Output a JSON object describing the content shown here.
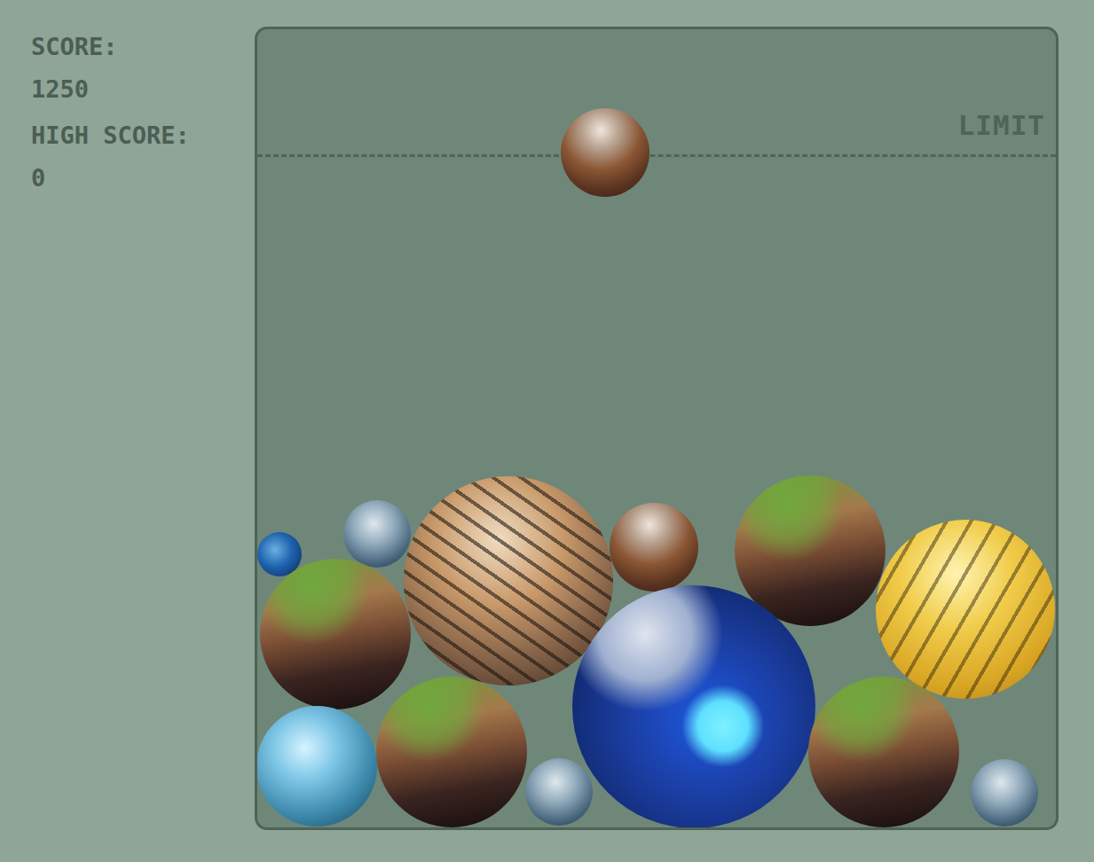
{
  "score": {
    "label": "SCORE:",
    "value": "1250"
  },
  "high_score": {
    "label": "HIGH SCORE:",
    "value": "0"
  },
  "board": {
    "limit_label": "LIMIT"
  },
  "dropping": {
    "kind": "rocky"
  },
  "planets": [
    {
      "kind": "ocean-small"
    },
    {
      "kind": "ice"
    },
    {
      "kind": "pattern"
    },
    {
      "kind": "rocky"
    },
    {
      "kind": "grass"
    },
    {
      "kind": "grass"
    },
    {
      "kind": "gold"
    },
    {
      "kind": "ocean"
    },
    {
      "kind": "ice-blue"
    },
    {
      "kind": "grass"
    },
    {
      "kind": "ice"
    },
    {
      "kind": "grass"
    },
    {
      "kind": "ice"
    }
  ]
}
